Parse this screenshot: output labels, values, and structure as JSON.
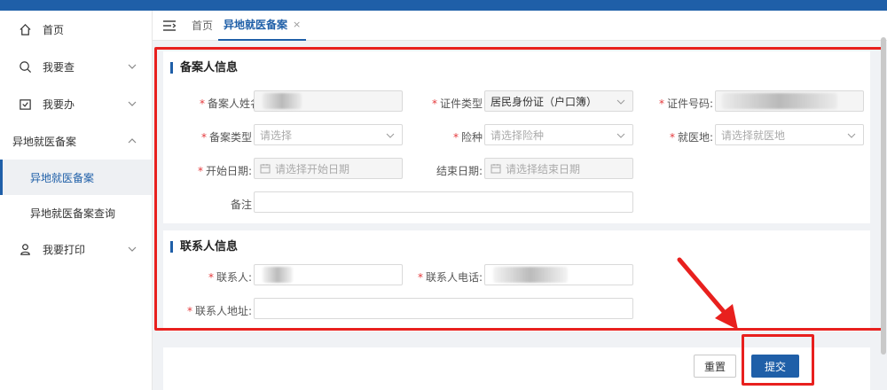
{
  "sidebar": {
    "items": [
      {
        "label": "首页",
        "icon": "home-icon"
      },
      {
        "label": "我要查",
        "icon": "search-icon"
      },
      {
        "label": "我要办",
        "icon": "inbox-icon"
      },
      {
        "label": "异地就医备案"
      },
      {
        "label": "异地就医备案"
      },
      {
        "label": "异地就医备案查询"
      },
      {
        "label": "我要打印",
        "icon": "person-icon"
      }
    ]
  },
  "tabs": {
    "home": "首页",
    "active": "异地就医备案",
    "close": "×"
  },
  "filer_section": {
    "title": "备案人信息",
    "name_label": "备案人姓名",
    "id_type_label": "证件类型",
    "id_type_value": "居民身份证（户口簿）",
    "id_number_label": "证件号码:",
    "filing_type_label": "备案类型",
    "filing_type_placeholder": "请选择",
    "insurance_label": "险种",
    "insurance_placeholder": "请选择险种",
    "treatment_place_label": "就医地:",
    "treatment_place_placeholder": "请选择就医地",
    "start_date_label": "开始日期:",
    "start_date_placeholder": "请选择开始日期",
    "end_date_label": "结束日期:",
    "end_date_placeholder": "请选择结束日期",
    "remark_label": "备注"
  },
  "contact_section": {
    "title": "联系人信息",
    "contact_name_label": "联系人:",
    "contact_phone_label": "联系人电话:",
    "contact_address_label": "联系人地址:"
  },
  "actions": {
    "reset": "重置",
    "submit": "提交"
  },
  "colors": {
    "accent": "#1f5fa8",
    "annotation": "#e8201e",
    "required": "#e4393c"
  }
}
